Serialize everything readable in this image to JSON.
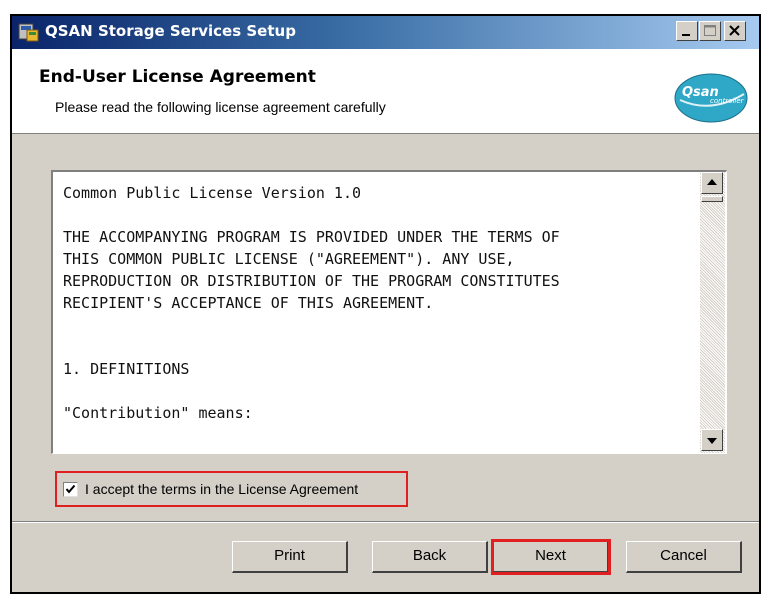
{
  "window": {
    "title": "QSAN Storage Services Setup",
    "controls": [
      "minimize-icon",
      "maximize-icon",
      "close-icon"
    ]
  },
  "header": {
    "title": "End-User License Agreement",
    "subtitle": "Please read the following license agreement carefully",
    "logo": {
      "text": "Qsan",
      "subtext": "controller"
    }
  },
  "license": {
    "lines": [
      "Common Public License Version 1.0",
      "",
      "THE ACCOMPANYING PROGRAM IS PROVIDED UNDER THE TERMS OF",
      "THIS COMMON PUBLIC LICENSE (\"AGREEMENT\"). ANY USE,",
      "REPRODUCTION OR DISTRIBUTION OF THE PROGRAM CONSTITUTES",
      "RECIPIENT'S ACCEPTANCE OF THIS AGREEMENT.",
      "",
      "",
      "1. DEFINITIONS",
      "",
      "\"Contribution\" means:"
    ]
  },
  "accept": {
    "label": "I accept the terms in the License Agreement",
    "checked": true
  },
  "buttons": {
    "print": "Print",
    "back": "Back",
    "next": "Next",
    "cancel": "Cancel"
  },
  "colors": {
    "highlight": "#e02020",
    "title_bar_start": "#0a246a",
    "title_bar_end": "#a6caf0",
    "dialog_face": "#d4d0c8"
  }
}
